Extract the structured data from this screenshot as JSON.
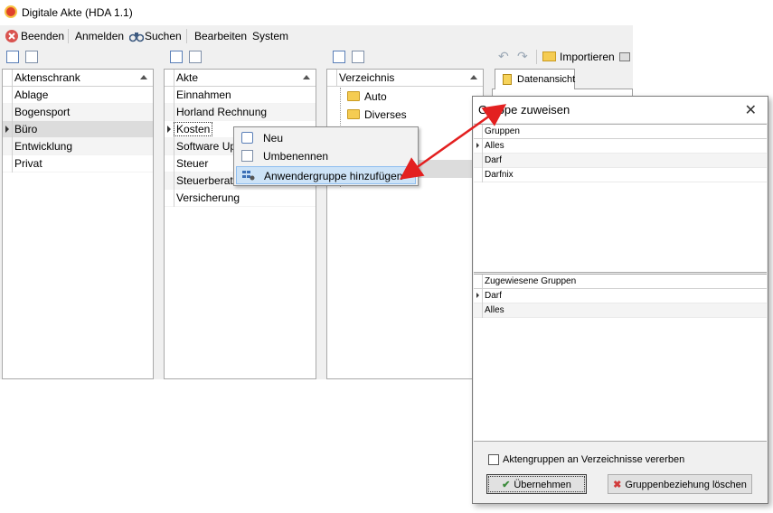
{
  "window": {
    "title": "Digitale Akte (HDA 1.1)"
  },
  "menubar": {
    "items": [
      {
        "label": "Beenden",
        "icon": "close-circle-icon"
      },
      {
        "label": "Anmelden"
      },
      {
        "label": "Suchen",
        "icon": "binoculars-icon"
      },
      {
        "label": "Bearbeiten"
      },
      {
        "label": "System"
      }
    ]
  },
  "toolbar": {
    "import_label": "Importieren"
  },
  "panels": {
    "aktenschrank": {
      "header": "Aktenschrank",
      "rows": [
        "Ablage",
        "Bogensport",
        "Büro",
        "Entwicklung",
        "Privat"
      ],
      "selected": "Büro"
    },
    "akte": {
      "header": "Akte",
      "rows": [
        "Einnahmen",
        "Horland Rechnung",
        "Kosten",
        "Software Up",
        "Steuer",
        "Steuerberat",
        "Versicherung"
      ],
      "selected": "Kosten"
    },
    "verzeichnis": {
      "header": "Verzeichnis",
      "rows": [
        "Auto",
        "Diverses"
      ]
    }
  },
  "tab": {
    "label": "Datenansicht"
  },
  "context_menu": {
    "items": [
      {
        "label": "Neu",
        "icon": "add-icon"
      },
      {
        "label": "Umbenennen",
        "icon": "edit-icon"
      },
      {
        "label": "Anwendergruppe hinzufügen",
        "icon": "group-icon"
      }
    ]
  },
  "dialog": {
    "title": "Gruppe zuweisen",
    "gruppen": {
      "header": "Gruppen",
      "rows": [
        "Alles",
        "Darf",
        "Darfnix"
      ]
    },
    "zugewiesen": {
      "header": "Zugewiesene Gruppen",
      "rows": [
        "Darf",
        "Alles"
      ]
    },
    "checkbox_label": "Aktengruppen an Verzeichnisse vererben",
    "ok_label": "Übernehmen",
    "delete_label": "Gruppenbeziehung löschen"
  },
  "colors": {
    "arrow": "#e32020",
    "highlight": "#cde3f7"
  }
}
